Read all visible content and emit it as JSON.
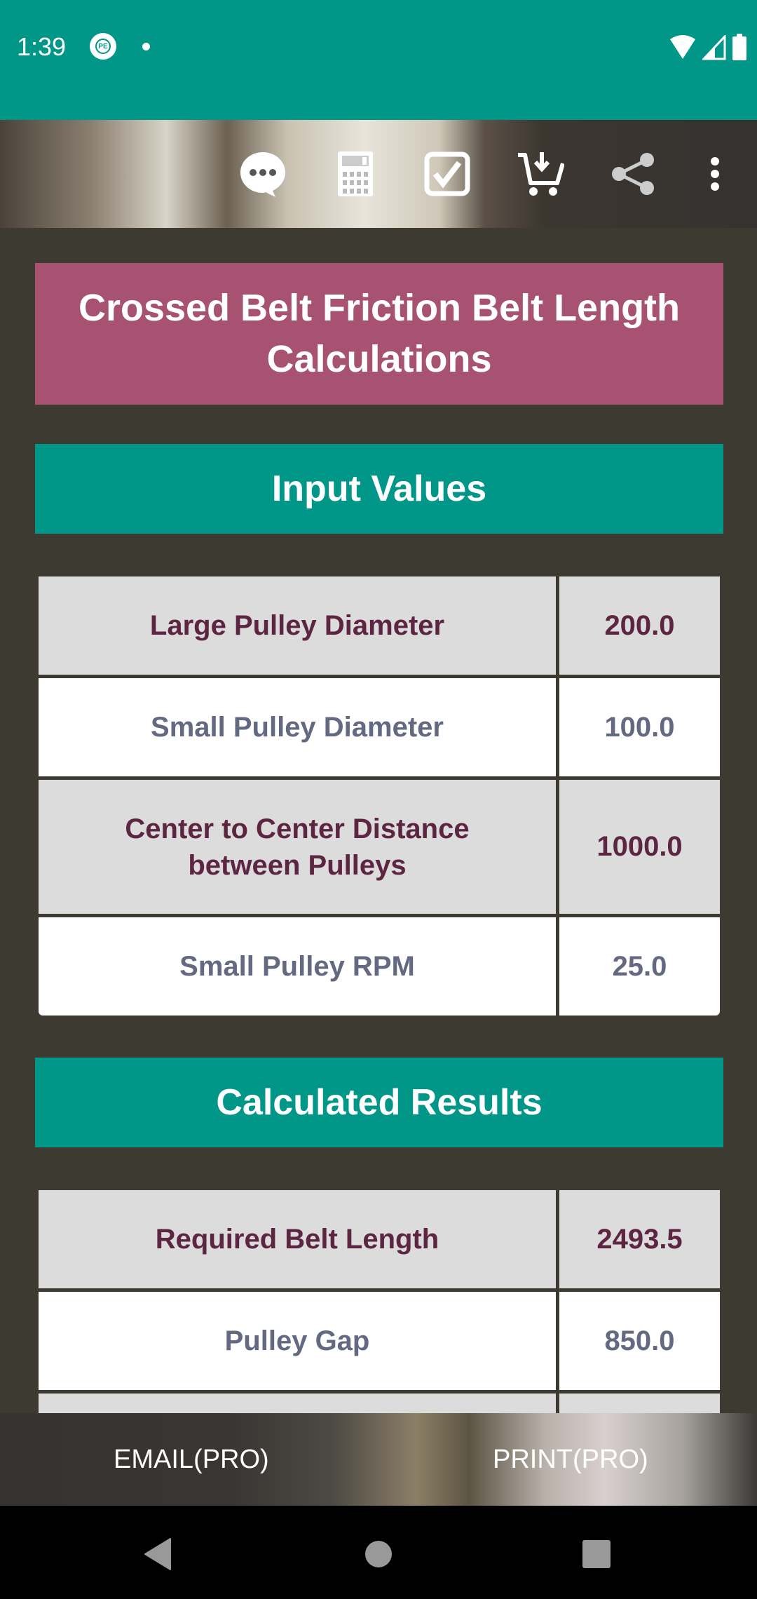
{
  "status_bar": {
    "time": "1:39",
    "notification_icon": "pe-app-icon",
    "pe_label": "PE",
    "icons": [
      "wifi-icon",
      "signal-icon",
      "battery-icon"
    ]
  },
  "toolbar": {
    "actions": [
      {
        "name": "chat-icon"
      },
      {
        "name": "calculator-icon"
      },
      {
        "name": "checkbox-icon"
      },
      {
        "name": "cart-download-icon"
      },
      {
        "name": "share-icon"
      },
      {
        "name": "more-vert-icon"
      }
    ]
  },
  "page": {
    "title": "Crossed Belt Friction Belt Length Calculations"
  },
  "input_section": {
    "header": "Input Values",
    "rows": [
      {
        "label": "Large Pulley Diameter",
        "value": "200.0"
      },
      {
        "label": "Small Pulley Diameter",
        "value": "100.0"
      },
      {
        "label": "Center to Center Distance between Pulleys",
        "value": "1000.0"
      },
      {
        "label": "Small Pulley RPM",
        "value": "25.0"
      }
    ]
  },
  "results_section": {
    "header": "Calculated Results",
    "rows": [
      {
        "label": "Required Belt Length",
        "value": "2493.5"
      },
      {
        "label": "Pulley Gap",
        "value": "850.0"
      }
    ]
  },
  "bottom_bar": {
    "email_label": "EMAIL(PRO)",
    "print_label": "PRINT(PRO)"
  },
  "colors": {
    "primary_teal": "#009688",
    "title_pink": "#a85271",
    "background": "#3d3a31",
    "row_gray": "#dcdcdc",
    "text_maroon": "#5c2642",
    "text_slate": "#646982"
  }
}
